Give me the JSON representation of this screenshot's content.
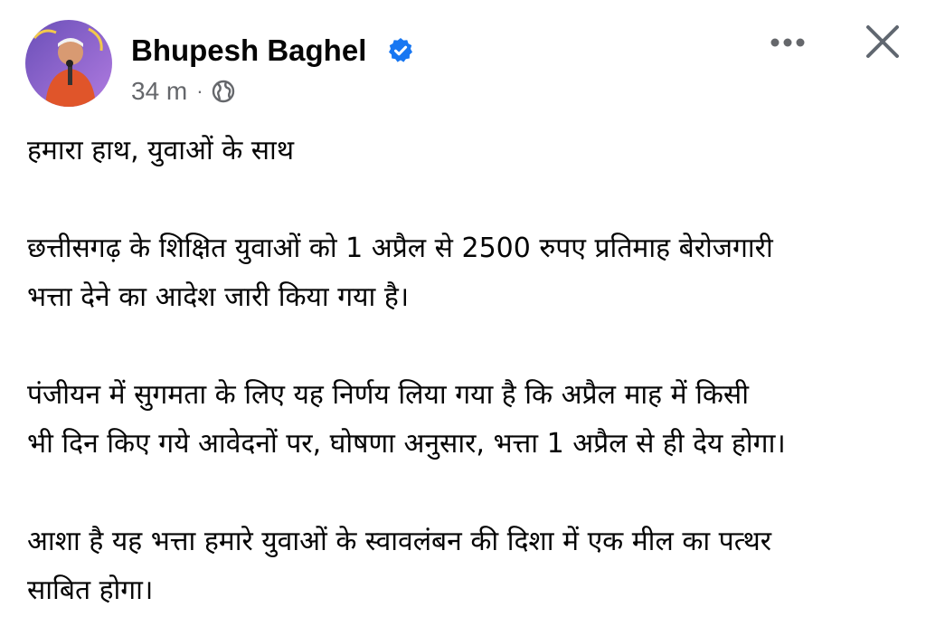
{
  "post": {
    "author": "Bhupesh Baghel",
    "time": "34 m",
    "separator": "·",
    "audience_icon": "globe-icon",
    "verified_icon": "verified-badge-icon",
    "more_icon": "more-options-icon",
    "close_icon": "close-icon",
    "colors": {
      "verified": "#1877f2",
      "meta_text": "#65676b",
      "text": "#050505"
    },
    "paragraphs": [
      {
        "lines": [
          "हमारा हाथ, युवाओं के साथ"
        ]
      },
      {
        "lines": [
          "छत्तीसगढ़ के शिक्षित युवाओं को 1 अप्रैल से 2500 रुपए प्रतिमाह बेरोजगारी",
          "भत्ता देने का आदेश जारी किया गया है।"
        ]
      },
      {
        "lines": [
          "पंजीयन में सुगमता के लिए यह निर्णय लिया गया है कि अप्रैल माह में किसी",
          "भी दिन किए गये आवेदनों पर, घोषणा अनुसार, भत्ता 1 अप्रैल से ही देय होगा।"
        ]
      },
      {
        "lines": [
          "आशा है यह भत्ता हमारे युवाओं के स्वावलंबन की दिशा में एक मील का पत्थर",
          "साबित होगा।"
        ]
      }
    ]
  }
}
